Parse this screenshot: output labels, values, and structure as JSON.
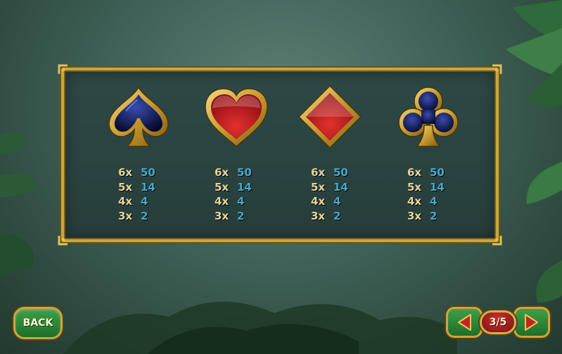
{
  "paytable": [
    {
      "suit": "spade",
      "icon": "spade-icon",
      "rows": [
        {
          "mult": "6x",
          "value": "50"
        },
        {
          "mult": "5x",
          "value": "14"
        },
        {
          "mult": "4x",
          "value": "4"
        },
        {
          "mult": "3x",
          "value": "2"
        }
      ]
    },
    {
      "suit": "heart",
      "icon": "heart-icon",
      "rows": [
        {
          "mult": "6x",
          "value": "50"
        },
        {
          "mult": "5x",
          "value": "14"
        },
        {
          "mult": "4x",
          "value": "4"
        },
        {
          "mult": "3x",
          "value": "2"
        }
      ]
    },
    {
      "suit": "diamond",
      "icon": "diamond-icon",
      "rows": [
        {
          "mult": "6x",
          "value": "50"
        },
        {
          "mult": "5x",
          "value": "14"
        },
        {
          "mult": "4x",
          "value": "4"
        },
        {
          "mult": "3x",
          "value": "2"
        }
      ]
    },
    {
      "suit": "club",
      "icon": "club-icon",
      "rows": [
        {
          "mult": "6x",
          "value": "50"
        },
        {
          "mult": "5x",
          "value": "14"
        },
        {
          "mult": "4x",
          "value": "4"
        },
        {
          "mult": "3x",
          "value": "2"
        }
      ]
    }
  ],
  "buttons": {
    "back_label": "BACK",
    "page_indicator": "3/5",
    "prev_icon": "arrow-left-icon",
    "next_icon": "arrow-right-icon"
  },
  "colors": {
    "gold_frame": "#c9a640",
    "multiplier_text": "#e6d49a",
    "payout_text": "#46a9c9",
    "button_green": "#2e8a3a",
    "page_pill_red": "#a82222"
  }
}
